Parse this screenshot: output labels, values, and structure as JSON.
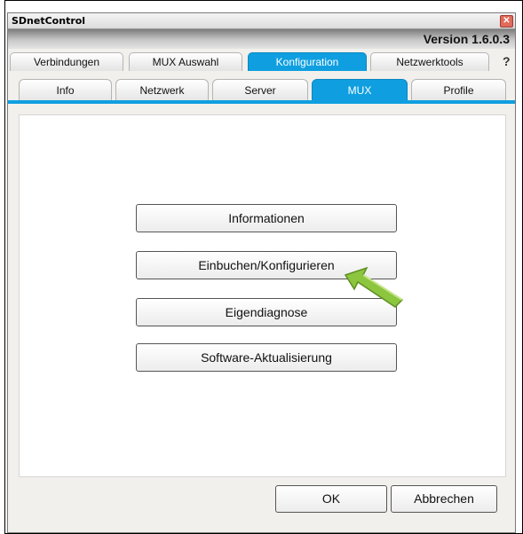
{
  "window": {
    "title": "SDnetControl",
    "version": "Version 1.6.0.3"
  },
  "main_tabs": [
    {
      "label": "Verbindungen",
      "active": false
    },
    {
      "label": "MUX Auswahl",
      "active": false
    },
    {
      "label": "Konfiguration",
      "active": true
    },
    {
      "label": "Netzwerktools",
      "active": false
    }
  ],
  "help_label": "?",
  "sub_tabs": [
    {
      "label": "Info",
      "active": false
    },
    {
      "label": "Netzwerk",
      "active": false
    },
    {
      "label": "Server",
      "active": false
    },
    {
      "label": "MUX",
      "active": true
    },
    {
      "label": "Profile",
      "active": false
    }
  ],
  "actions": {
    "informationen": "Informationen",
    "einbuchen": "Einbuchen/Konfigurieren",
    "eigendiagnose": "Eigendiagnose",
    "software": "Software-Aktualisierung"
  },
  "dialog": {
    "ok": "OK",
    "cancel": "Abbrechen"
  },
  "colors": {
    "accent": "#0f9fe0",
    "arrow": "#8cc63f"
  },
  "icons": {
    "close": "close-icon",
    "help": "help-icon",
    "pointer": "pointer-arrow-icon"
  }
}
